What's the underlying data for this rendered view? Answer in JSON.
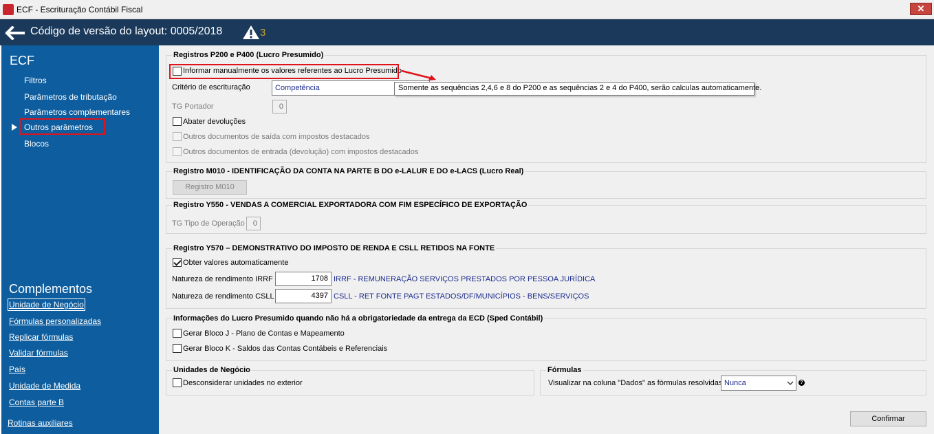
{
  "window": {
    "title": "ECF - Escrituração Contábil Fiscal",
    "close_label": "✕"
  },
  "header": {
    "title": "Código de versão do layout: 0005/2018",
    "warning_count": "3"
  },
  "sidebar": {
    "section_title": "ECF",
    "items": [
      "Filtros",
      "Parâmetros de tributação",
      "Parâmetros complementares",
      "Outros parâmetros",
      "Blocos"
    ],
    "selected_index": 3,
    "complementos_title": "Complementos",
    "complementos_links": [
      "Unidade de Negócio",
      "Fórmulas personalizadas",
      "Replicar fórmulas",
      "Validar fórmulas",
      "País",
      "Unidade de Medida",
      "Contas parte B"
    ],
    "rotinas": "Rotinas auxiliares"
  },
  "p200": {
    "title": "Registros P200 e P400 (Lucro Presumido)",
    "manual_checkbox": "Informar manualmente os valores referentes ao Lucro Presumido",
    "criterio_label": "Critério de escrituração",
    "criterio_value": "Competência",
    "tooltip": "Somente as sequências 2,4,6 e 8 do P200 e as sequências 2 e 4 do P400, serão calculas automaticamente.",
    "tg_portador_label": "TG Portador",
    "tg_portador_value": "0",
    "abater_label": "Abater devoluções",
    "saida_label": "Outros documentos de saída com impostos destacados",
    "entrada_label": "Outros documentos de entrada (devolução) com impostos destacados"
  },
  "m010": {
    "title": "Registro M010 - IDENTIFICAÇÃO DA CONTA NA PARTE B DO e-LALUR E DO e-LACS (Lucro Real)",
    "button": "Registro M010"
  },
  "y550": {
    "title": "Registro Y550 - VENDAS A COMERCIAL EXPORTADORA COM FIM ESPECÍFICO DE EXPORTAÇÃO",
    "tg_label": "TG Tipo de Operação",
    "tg_value": "0"
  },
  "y570": {
    "title": "Registro Y570 – DEMONSTRATIVO DO IMPOSTO DE RENDA E CSLL RETIDOS NA FONTE",
    "obter_label": "Obter valores automaticamente",
    "irrf_label": "Natureza de rendimento IRRF",
    "irrf_value": "1708",
    "irrf_desc": "IRRF - REMUNERAÇÃO SERVIÇOS PRESTADOS POR PESSOA JURÍDICA",
    "csll_label": "Natureza de rendimento CSLL",
    "csll_value": "4397",
    "csll_desc": "CSLL - RET FONTE PAGT ESTADOS/DF/MUNICÍPIOS - BENS/SERVIÇOS"
  },
  "ecd": {
    "title": "Informações do Lucro Presumido quando não há a obrigatoriedade da entrega da ECD (Sped Contábil)",
    "bloco_j": "Gerar Bloco J - Plano de Contas e Mapeamento",
    "bloco_k": "Gerar Bloco K - Saldos das Contas Contábeis e Referenciais"
  },
  "unidades": {
    "title": "Unidades de Negócio",
    "desconsiderar": "Desconsiderar unidades no exterior"
  },
  "formulas": {
    "title": "Fórmulas",
    "visualizar_label": "Visualizar na coluna \"Dados\" as fórmulas resolvidas",
    "visualizar_value": "Nunca"
  },
  "footer": {
    "confirmar": "Confirmar"
  },
  "colors": {
    "header_bg": "#1b3a5b",
    "sidebar_bg": "#0e5e9f",
    "highlight_red": "#e0131b",
    "desc_blue": "#1b2b8c"
  }
}
